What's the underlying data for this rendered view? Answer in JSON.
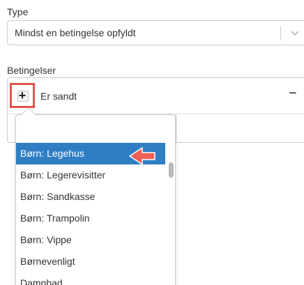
{
  "type_field": {
    "label": "Type",
    "value": "Mindst en betingelse opfyldt",
    "chevron_icon": "chevron-down-icon"
  },
  "conditions": {
    "label": "Betingelser",
    "add_symbol": "+",
    "condition_text": "Er sandt",
    "remove_symbol": "−"
  },
  "dropdown": {
    "search_value": "",
    "items": [
      {
        "label": "Børn: Legehus",
        "active": true
      },
      {
        "label": "Børn: Legerevisitter",
        "active": false
      },
      {
        "label": "Børn: Sandkasse",
        "active": false
      },
      {
        "label": "Børn: Trampolin",
        "active": false
      },
      {
        "label": "Børn: Vippe",
        "active": false
      },
      {
        "label": "Børnevenligt",
        "active": false
      },
      {
        "label": "Dampbad",
        "active": false
      }
    ]
  },
  "colors": {
    "highlight": "#2f7ec4",
    "annotation": "#e4534a"
  }
}
